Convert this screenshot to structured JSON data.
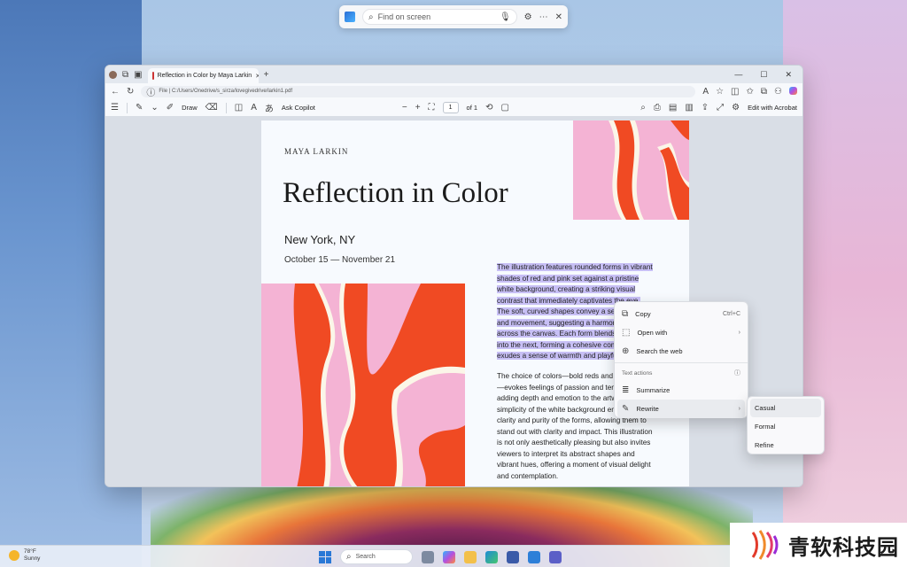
{
  "find_bar": {
    "placeholder": "Find on screen"
  },
  "browser": {
    "tab_title": "Reflection in Color by Maya Larkin",
    "url": "File | C:/Users/Onedrive/s_sirza/lovegivedrive/larkin1.pdf"
  },
  "pdf_toolbar": {
    "draw_label": "Draw",
    "ask_copilot_label": "Ask Copilot",
    "page_number": "1",
    "page_total": "of 1",
    "edit_label": "Edit with Acrobat"
  },
  "document": {
    "author": "MAYA LARKIN",
    "title": "Reflection in Color",
    "city": "New York, NY",
    "dates": "October 15 — November 21",
    "paragraph1_lines": [
      "The illustration features rounded forms in vibrant",
      "shades of red and pink set against a pristine",
      "white background, creating a striking visual",
      "contrast that immediately captivates the eye.",
      "The soft, curved shapes convey a sense of flow",
      "and movement, suggesting a harmonious dance",
      "across the canvas. Each form blends seamlessly",
      "into the next, forming a cohesive composition that",
      "exudes a sense of warmth and playfulness."
    ],
    "paragraph2_lines": [
      "The choice of colors—bold reds and soft pinks",
      "—evokes feelings of passion and tenderness,",
      "adding depth and emotion to the artwork. The",
      "simplicity of the white background enhances the",
      "clarity and purity of the forms, allowing them to",
      "stand out with clarity and impact. This illustration",
      "is not only aesthetically pleasing but also invites",
      "viewers to interpret its abstract shapes and",
      "vibrant hues, offering a moment of visual delight",
      "and contemplation."
    ]
  },
  "context_menu": {
    "copy": "Copy",
    "copy_shortcut": "Ctrl+C",
    "open_with": "Open with",
    "search_web": "Search the web",
    "text_actions": "Text actions",
    "summarize": "Summarize",
    "rewrite": "Rewrite"
  },
  "rewrite_submenu": [
    "Casual",
    "Formal",
    "Refine"
  ],
  "taskbar": {
    "temperature": "78°F",
    "condition": "Sunny",
    "search_label": "Search"
  },
  "watermark": "青软科技园",
  "colors": {
    "art_red": "#f04a23",
    "art_pink": "#f4b3d4",
    "art_cream": "#fbf6e8",
    "selection": "#c7bff5"
  }
}
